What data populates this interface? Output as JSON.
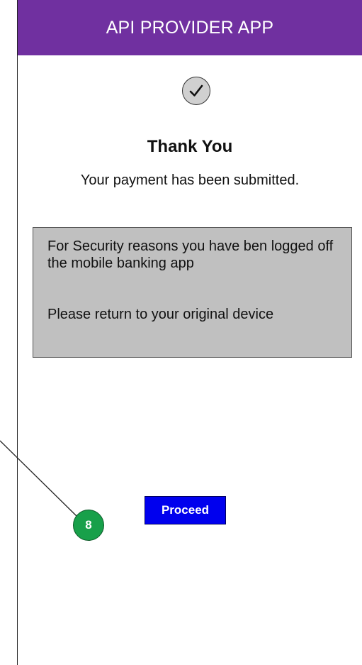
{
  "header": {
    "title": "API PROVIDER APP",
    "background": "#7030a0"
  },
  "confirmation": {
    "icon": "checkmark-icon",
    "title": "Thank You",
    "subtitle": "Your payment has been submitted."
  },
  "security_notice": {
    "message": "For Security reasons you have ben logged off the mobile banking app",
    "instruction": "Please return to your original device",
    "background": "#c0c0c0"
  },
  "actions": {
    "proceed_label": "Proceed",
    "proceed_color": "#0000ee"
  },
  "callout": {
    "number": "8",
    "color": "#18a04a"
  }
}
